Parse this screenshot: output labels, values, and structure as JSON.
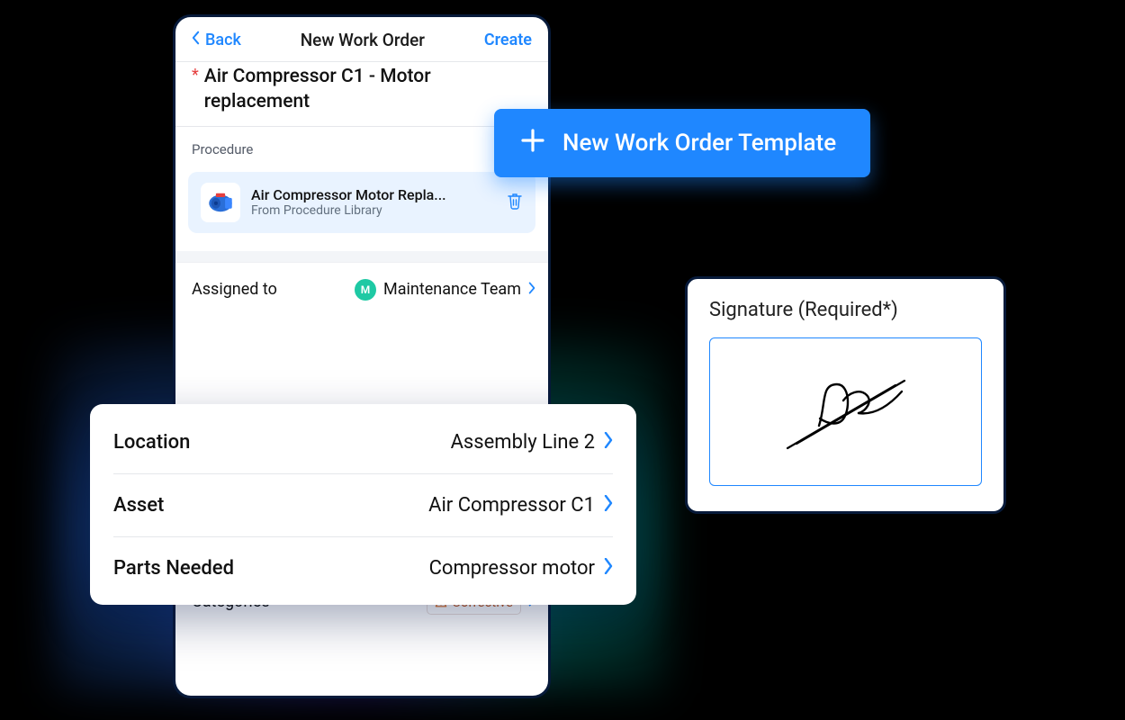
{
  "header": {
    "back": "Back",
    "title": "New Work Order",
    "create": "Create"
  },
  "workorder": {
    "title": "Air Compressor C1 - Motor replacement",
    "procedure_label": "Procedure",
    "procedure": {
      "name": "Air Compressor Motor Repla...",
      "source": "From Procedure Library"
    },
    "assigned_label": "Assigned to",
    "assigned_value": "Maintenance Team",
    "assigned_initial": "M",
    "categories_label": "Categories",
    "category_tag": "Corrective"
  },
  "details": [
    {
      "label": "Location",
      "value": "Assembly Line 2"
    },
    {
      "label": "Asset",
      "value": "Air Compressor C1"
    },
    {
      "label": "Parts Needed",
      "value": "Compressor motor"
    }
  ],
  "template_button": "New Work Order Template",
  "signature": {
    "title": "Signature (Required*)"
  }
}
